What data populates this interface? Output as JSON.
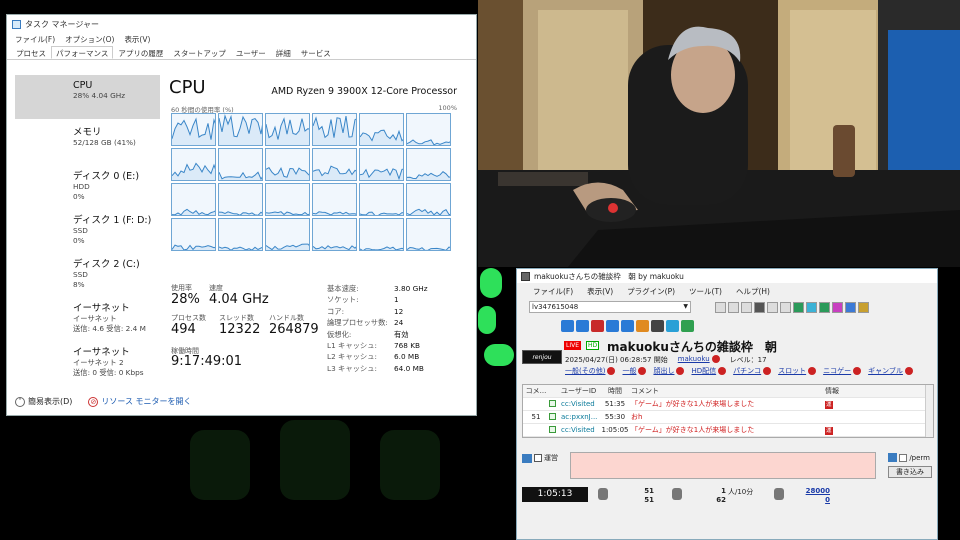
{
  "task_manager": {
    "title": "タスク マネージャー",
    "menu": [
      "ファイル(F)",
      "オプション(O)",
      "表示(V)"
    ],
    "tabs": [
      "プロセス",
      "パフォーマンス",
      "アプリの履歴",
      "スタートアップ",
      "ユーザー",
      "詳細",
      "サービス"
    ],
    "active_tab": "パフォーマンス",
    "sidebar": [
      {
        "title": "CPU",
        "lines": [
          "28% 4.04 GHz"
        ]
      },
      {
        "title": "メモリ",
        "lines": [
          "52/128 GB (41%)"
        ]
      },
      {
        "title": "ディスク 0 (E:)",
        "lines": [
          "HDD",
          "0%"
        ]
      },
      {
        "title": "ディスク 1 (F: D:)",
        "lines": [
          "SSD",
          "0%"
        ]
      },
      {
        "title": "ディスク 2 (C:)",
        "lines": [
          "SSD",
          "8%"
        ]
      },
      {
        "title": "イーサネット",
        "lines": [
          "イーサネット",
          "送信: 4.6 受信: 2.4 M"
        ]
      },
      {
        "title": "イーサネット",
        "lines": [
          "イーサネット 2",
          "送信: 0 受信: 0 Kbps"
        ]
      }
    ],
    "cpu_title": "CPU",
    "cpu_model": "AMD Ryzen 9 3900X 12-Core Processor",
    "util_label": "60 秒間の使用率 (%)",
    "util_max": "100%",
    "core_levels": [
      0.55,
      0.6,
      0.55,
      0.6,
      0.35,
      0.15,
      0.4,
      0.2,
      0.3,
      0.3,
      0.25,
      0.2,
      0.15,
      0.1,
      0.1,
      0.1,
      0.1,
      0.15,
      0.15,
      0.1,
      0.15,
      0.15,
      0.1,
      0.1
    ],
    "stats": {
      "usage_label": "使用率",
      "usage": "28%",
      "speed_label": "速度",
      "speed": "4.04 GHz",
      "process_label": "プロセス数",
      "process": "494",
      "thread_label": "スレッド数",
      "thread": "12322",
      "handle_label": "ハンドル数",
      "handle": "264879",
      "uptime_label": "稼働時間",
      "uptime": "9:17:49:01"
    },
    "specs": [
      {
        "k": "基本速度:",
        "v": "3.80 GHz"
      },
      {
        "k": "ソケット:",
        "v": "1"
      },
      {
        "k": "コア:",
        "v": "12"
      },
      {
        "k": "論理プロセッサ数:",
        "v": "24"
      },
      {
        "k": "仮想化:",
        "v": "有効"
      },
      {
        "k": "L1 キャッシュ:",
        "v": "768 KB"
      },
      {
        "k": "L2 キャッシュ:",
        "v": "6.0 MB"
      },
      {
        "k": "L3 キャッシュ:",
        "v": "64.0 MB"
      }
    ],
    "bottom": {
      "simple": "簡易表示(D)",
      "monitor": "リソース モニターを開く"
    }
  },
  "viewer": {
    "title": "makuokuさんちの雑談枠　朝 by makuoku",
    "menu": [
      "ファイル(F)",
      "表示(V)",
      "プラグイン(P)",
      "ツール(T)",
      "ヘルプ(H)"
    ],
    "live_id": "lv347615048",
    "logo": "renjou",
    "live_badge": "LIVE",
    "hd_badge": "HD",
    "broadcast_title": "makuokuさんちの雑談枠　朝",
    "date": "2025/04/27(日) 06:28:57 開始",
    "owner": "makuoku",
    "level": "レベル：17",
    "links": [
      "一般(その他)",
      "一般",
      "顔出し",
      "HD配信",
      "パチンコ",
      "スロット",
      "ニコゲー",
      "ギャンブル"
    ],
    "table_headers": [
      "コメ...",
      "ユーザーID",
      "時間",
      "コメント",
      "情報"
    ],
    "comments": [
      {
        "no": "",
        "uid": "cc:Visited",
        "time": "51:35",
        "text": "「ゲーム」が好きな1人が来場しました",
        "info": "運"
      },
      {
        "no": "51",
        "uid": "ac:pxxnJ...",
        "time": "55:30",
        "text": "おh",
        "info": ""
      },
      {
        "no": "",
        "uid": "cc:Visited",
        "time": "1:05:05",
        "text": "「ゲーム」が好きな1人が来場しました",
        "info": "運"
      }
    ],
    "post": {
      "unei": "運営",
      "perm": "/perm",
      "submit": "書き込み"
    },
    "status": {
      "elapsed": "1:05:13",
      "comments_a": "51",
      "comments_b": "51",
      "visitors": "1",
      "rate": "人/10分",
      "visitors_total": "62",
      "points_a": "28000",
      "points_b": "0"
    }
  },
  "colors": {
    "cpu_line": "#3a86c8",
    "cpu_fill": "#dbeaf8",
    "red_flag": "#cc2222"
  }
}
